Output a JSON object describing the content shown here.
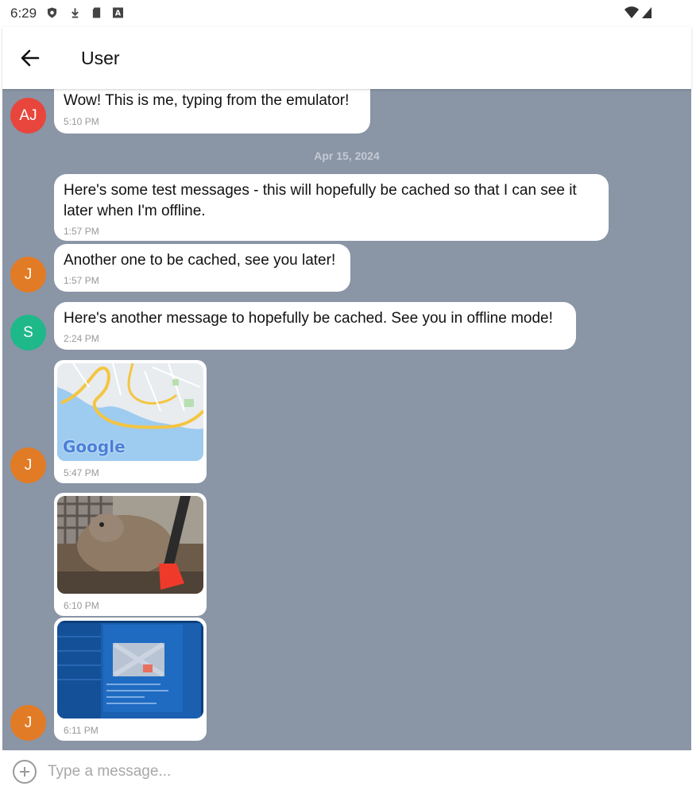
{
  "status_bar": {
    "time": "6:29",
    "icons": [
      "shield-icon",
      "download-icon",
      "sd-card-icon",
      "letter-a-icon"
    ],
    "right_icons": [
      "wifi-icon",
      "signal-icon"
    ]
  },
  "header": {
    "back_icon": "arrow-left-icon",
    "title": "User"
  },
  "colors": {
    "chat_bg": "#8a95a6",
    "avatar_aj": "#e8463c",
    "avatar_j": "#e27b25",
    "avatar_s": "#1fb889"
  },
  "date_separator": "Apr 15, 2024",
  "messages": [
    {
      "avatar": "AJ",
      "text": "Wow! This is me, typing from the emulator!",
      "time": "5:10 PM"
    },
    {
      "avatar": "",
      "text": "Here's some test messages - this will hopefully be cached so that I can see it later when I'm offline.",
      "time": "1:57 PM"
    },
    {
      "avatar": "J",
      "text": "Another one to be cached, see you later!",
      "time": "1:57 PM"
    },
    {
      "avatar": "S",
      "text": "Here's another message to hopefully be cached. See you in offline mode!",
      "time": "2:24 PM"
    },
    {
      "avatar": "",
      "image": "map-image",
      "map_logo": "Google",
      "time": "5:47 PM"
    },
    {
      "avatar": "J",
      "image": "bird-photo",
      "time": "6:10 PM"
    },
    {
      "avatar": "",
      "image": "screen-photo",
      "time": "6:11 PM"
    }
  ],
  "avatar_labels": {
    "aj": "AJ",
    "j1": "J",
    "s": "S",
    "j2": "J",
    "j3": "J"
  },
  "input": {
    "placeholder": "Type a message...",
    "add_icon": "plus-circle-icon"
  }
}
